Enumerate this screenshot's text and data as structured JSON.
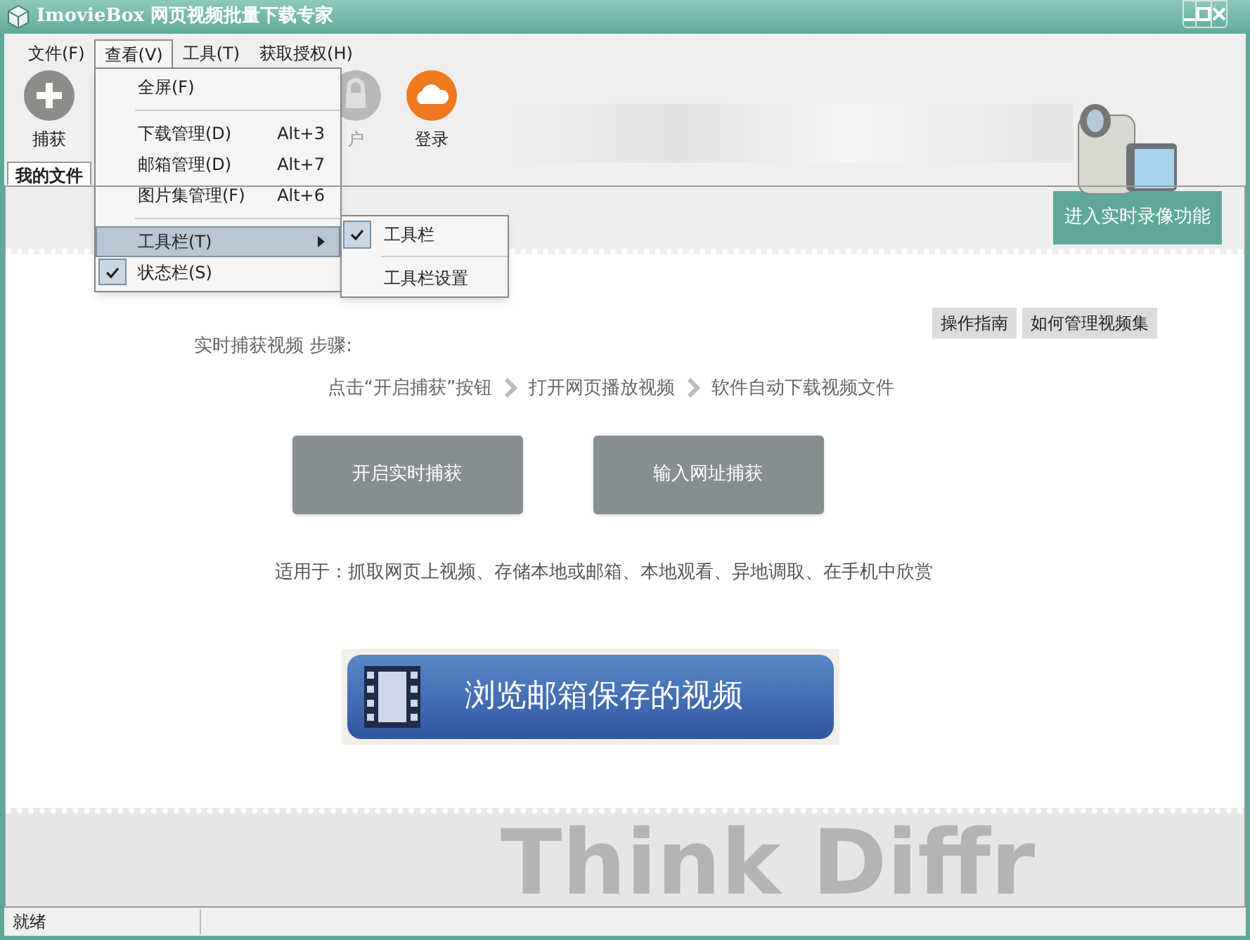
{
  "window": {
    "title": "ImovieBox 网页视频批量下载专家"
  },
  "menubar": [
    {
      "label": "文件(F)",
      "selected": false
    },
    {
      "label": "查看(V)",
      "selected": true
    },
    {
      "label": "工具(T)",
      "selected": false
    },
    {
      "label": "获取授权(H)",
      "selected": false
    }
  ],
  "toolbar": [
    {
      "kind": "add",
      "label": "捕获",
      "disabled": false
    },
    {
      "kind": "lock",
      "label": "户",
      "disabled": true
    },
    {
      "kind": "cloud",
      "label": "登录",
      "disabled": false
    }
  ],
  "tabs": [
    {
      "label": "我的文件",
      "selected": true
    }
  ],
  "view_menu": [
    {
      "kind": "item",
      "label": "全屏(F)"
    },
    {
      "kind": "separator"
    },
    {
      "kind": "item",
      "label": "下载管理(D)",
      "shortcut": "Alt+3"
    },
    {
      "kind": "item",
      "label": "邮箱管理(D)",
      "shortcut": "Alt+7"
    },
    {
      "kind": "item",
      "label": "图片集管理(F)",
      "shortcut": "Alt+6"
    },
    {
      "kind": "separator"
    },
    {
      "kind": "submenu",
      "label": "工具栏(T)",
      "selected": true
    },
    {
      "kind": "check",
      "label": "状态栏(S)",
      "checked": true
    }
  ],
  "toolbar_submenu": [
    {
      "kind": "check",
      "label": "工具栏",
      "checked": true
    },
    {
      "kind": "separator"
    },
    {
      "kind": "item",
      "label": "工具栏设置"
    }
  ],
  "record_button": "进入实时录像功能",
  "help_buttons": [
    "操作指南",
    "如何管理视频集"
  ],
  "steps_title": "实时捕获视频 步骤:",
  "steps": [
    "点击“开启捕获”按钮",
    "打开网页播放视频",
    "软件自动下载视频文件"
  ],
  "capture_buttons": [
    "开启实时捕获",
    "输入网址捕获"
  ],
  "usage": "适用于：抓取网页上视频、存储本地或邮箱、本地观看、异地调取、在手机中欣赏",
  "browse_button": "浏览邮箱保存的视频",
  "background_slogan": "Think Diffr",
  "status_bar": "就绪"
}
